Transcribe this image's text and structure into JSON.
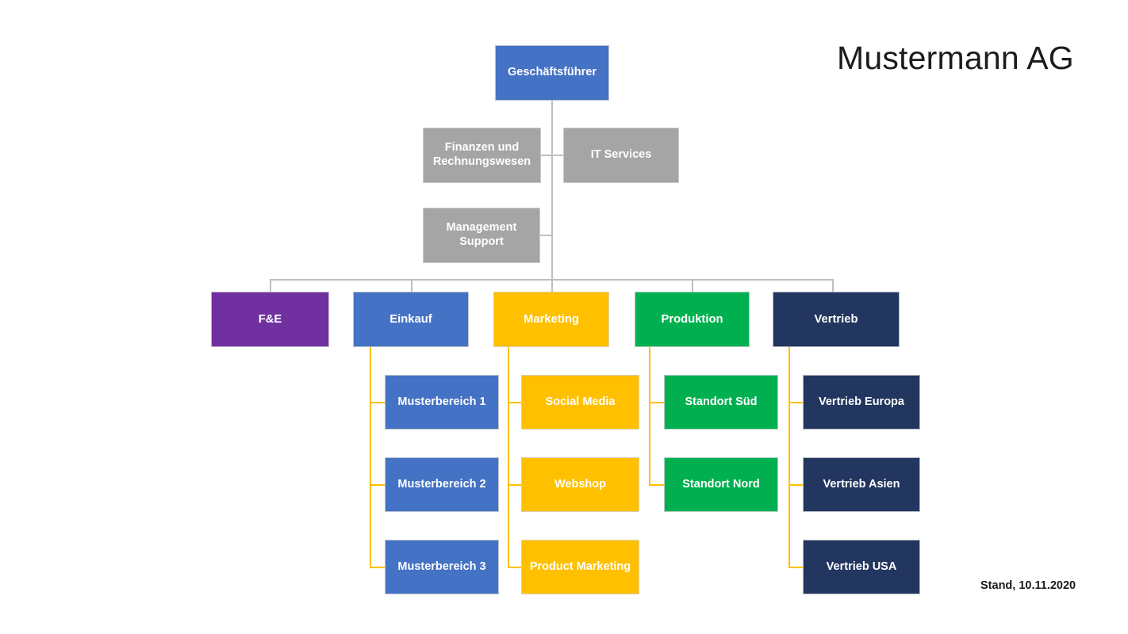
{
  "title": "Mustermann AG",
  "footer": {
    "date_label": "Stand, 10.11.2020"
  },
  "palette": {
    "ceo_blue": "#4472C4",
    "staff_gray": "#A5A5A5",
    "purple": "#7030A0",
    "blue": "#4472C4",
    "amber": "#FFC000",
    "green": "#00B050",
    "navy": "#22365F",
    "connector_gray": "#BFBFBF",
    "connector_amber": "#FFC000",
    "text_on_fill": "#FFFFFF",
    "title_text": "#1C1C1C"
  },
  "org": {
    "ceo": {
      "label": "Geschäftsführer"
    },
    "staff": [
      {
        "label": "Finanzen und Rechnungswesen"
      },
      {
        "label": "IT Services"
      },
      {
        "label": "Management Support"
      }
    ],
    "departments": [
      {
        "label": "F&E",
        "children": []
      },
      {
        "label": "Einkauf",
        "children": [
          {
            "label": "Musterbereich 1"
          },
          {
            "label": "Musterbereich 2"
          },
          {
            "label": "Musterbereich 3"
          }
        ]
      },
      {
        "label": "Marketing",
        "children": [
          {
            "label": "Social Media"
          },
          {
            "label": "Webshop"
          },
          {
            "label": "Product Marketing"
          }
        ]
      },
      {
        "label": "Produktion",
        "children": [
          {
            "label": "Standort Süd"
          },
          {
            "label": "Standort Nord"
          }
        ]
      },
      {
        "label": "Vertrieb",
        "children": [
          {
            "label": "Vertrieb Europa"
          },
          {
            "label": "Vertrieb Asien"
          },
          {
            "label": "Vertrieb USA"
          }
        ]
      }
    ]
  }
}
